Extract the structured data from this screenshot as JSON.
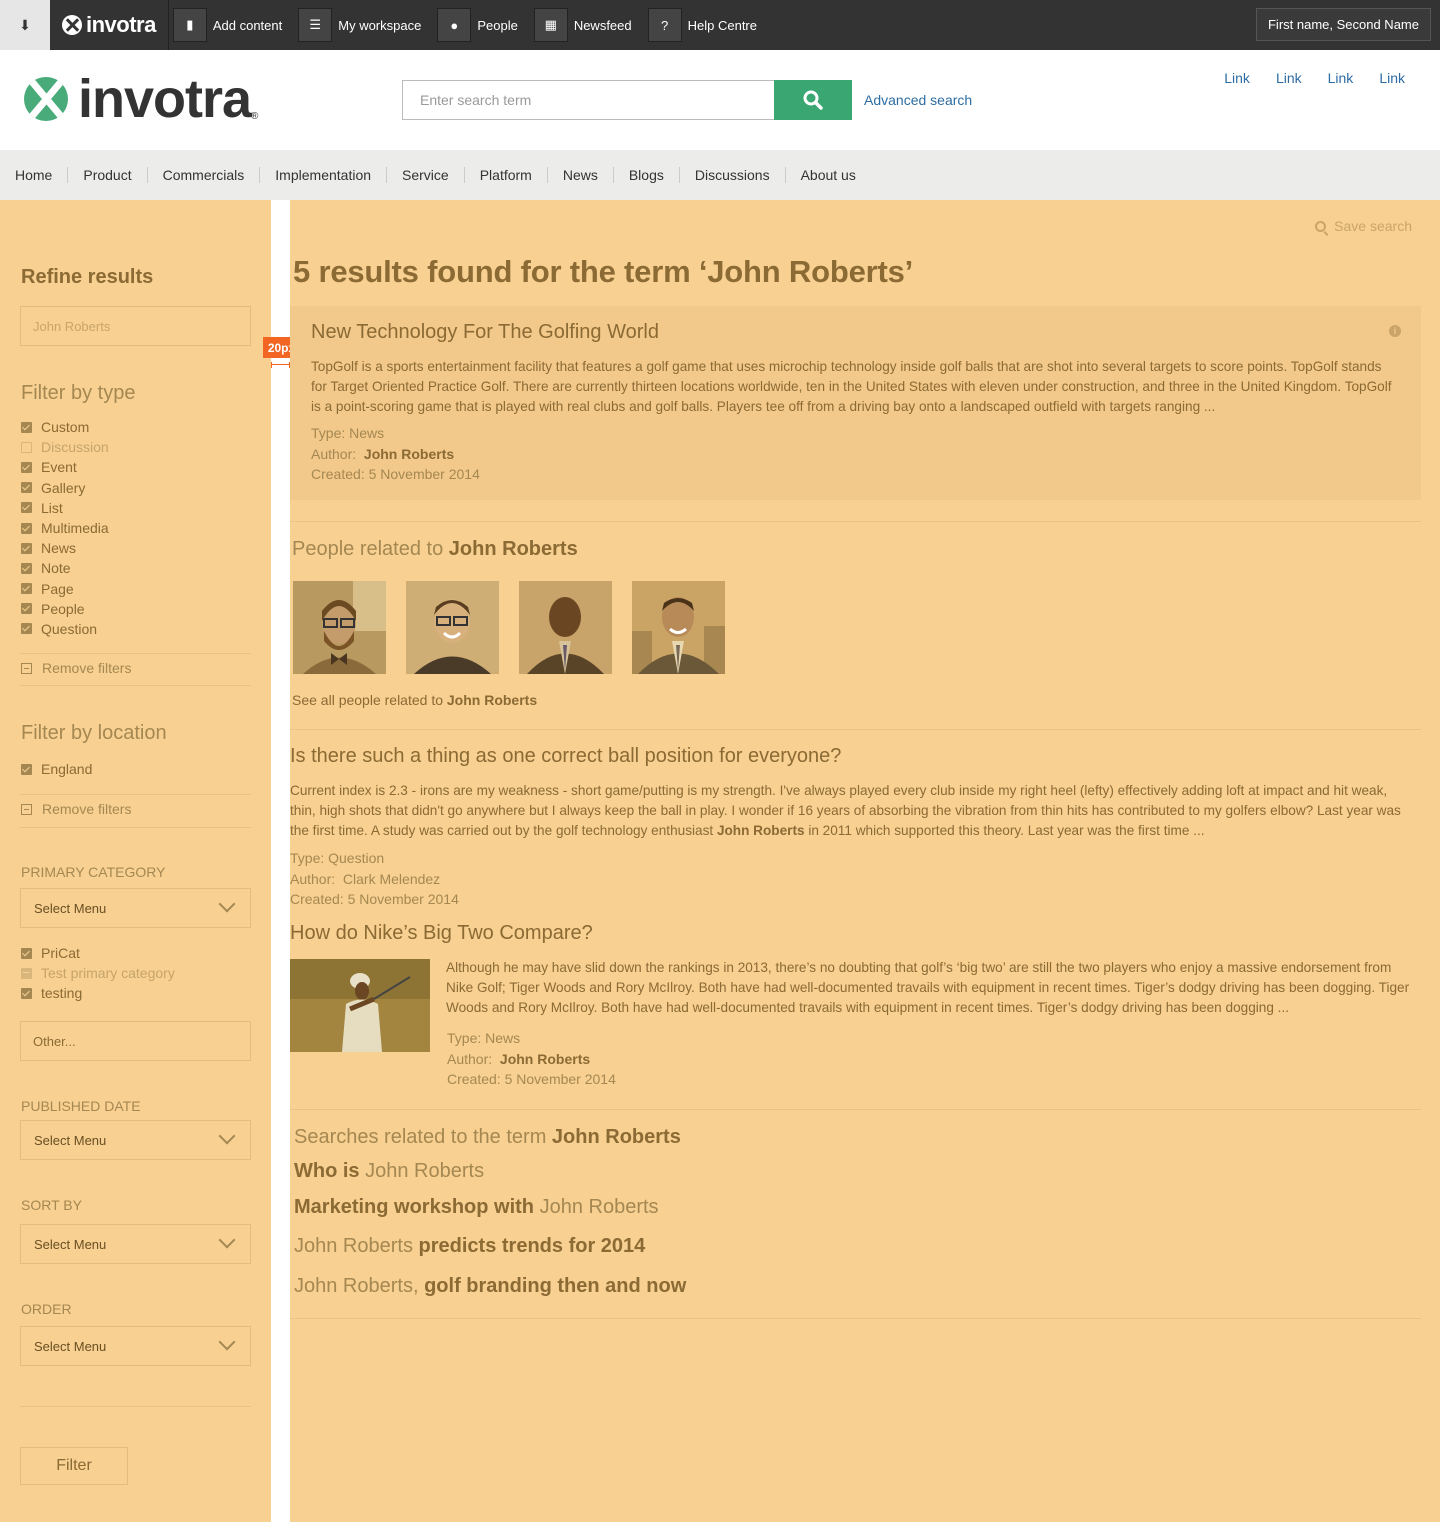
{
  "topbar": {
    "brand": "invotra",
    "items": [
      {
        "label": "Add content",
        "icon": "document-icon"
      },
      {
        "label": "My workspace",
        "icon": "list-icon"
      },
      {
        "label": "People",
        "icon": "people-icon"
      },
      {
        "label": "Newsfeed",
        "icon": "newspaper-icon"
      },
      {
        "label": "Help Centre",
        "icon": "question-icon"
      }
    ],
    "user": "First name, Second Name"
  },
  "header": {
    "logo": "invotra",
    "search_placeholder": "Enter search term",
    "advanced_search": "Advanced search",
    "links": [
      "Link",
      "Link",
      "Link",
      "Link"
    ]
  },
  "nav": [
    "Home",
    "Product",
    "Commercials",
    "Implementation",
    "Service",
    "Platform",
    "News",
    "Blogs",
    "Discussions",
    "About us"
  ],
  "sidebar": {
    "refine_title": "Refine results",
    "refine_value": "John Roberts",
    "filter_type_title": "Filter by type",
    "types": [
      {
        "label": "Custom",
        "state": "checked"
      },
      {
        "label": "Discussion",
        "state": "unchecked"
      },
      {
        "label": "Event",
        "state": "checked"
      },
      {
        "label": "Gallery",
        "state": "checked"
      },
      {
        "label": "List",
        "state": "checked"
      },
      {
        "label": "Multimedia",
        "state": "checked"
      },
      {
        "label": "News",
        "state": "checked"
      },
      {
        "label": "Note",
        "state": "checked"
      },
      {
        "label": "Page",
        "state": "checked"
      },
      {
        "label": "People",
        "state": "checked"
      },
      {
        "label": "Question",
        "state": "checked"
      }
    ],
    "remove_filters": "Remove filters",
    "filter_location_title": "Filter by location",
    "locations": [
      {
        "label": "England",
        "state": "checked"
      }
    ],
    "primary_category_caption": "PRIMARY CATEGORY",
    "primary_category_select": "Select Menu",
    "categories": [
      {
        "label": "PriCat",
        "state": "checked"
      },
      {
        "label": "Test primary category",
        "state": "indeterminate"
      },
      {
        "label": "testing",
        "state": "checked"
      }
    ],
    "other_placeholder": "Other...",
    "published_caption": "PUBLISHED DATE",
    "published_select": "Select Menu",
    "sort_caption": "SORT BY",
    "sort_select": "Select Menu",
    "order_caption": "ORDER",
    "order_select": "Select Menu",
    "filter_button": "Filter",
    "spacing_marker": "20px"
  },
  "main": {
    "save_search": "Save search",
    "results_title": "5 results found for the term ‘John Roberts’",
    "result1": {
      "title": "New Technology For The Golfing World",
      "body": "TopGolf is a sports entertainment facility that features a golf game that uses microchip technology inside golf balls that are shot into several targets to score points. TopGolf stands for Target Oriented Practice Golf. There are currently thirteen locations worldwide, ten in the United States with eleven under construction, and three in the United Kingdom. TopGolf is a point-scoring game that is played with real clubs and golf balls. Players tee off from a driving bay onto a landscaped outfield with targets ranging ...",
      "type": "Type: News",
      "author_label": "Author:",
      "author": "John Roberts",
      "created": "Created: 5 November 2014"
    },
    "people": {
      "title_prefix": "People related to",
      "title_name": "John Roberts",
      "see_all_prefix": "See all people related to",
      "see_all_name": "John Roberts"
    },
    "result2": {
      "title": "Is there such a thing as one correct ball position for everyone?",
      "body_1": "Current index is 2.3 - irons are my weakness - short game/putting is my strength. I've always played every club inside my right heel (lefty) effectively adding loft at impact and hit weak, thin, high shots that didn't go anywhere but I always keep the ball in play.  I wonder if 16 years of absorbing the vibration from thin hits has contributed to my golfers elbow? Last year was the first time.  A study was carried out by the golf technology enthusiast",
      "body_name": "John Roberts",
      "body_2": "in 2011 which supported this theory.  Last year was the first time ...",
      "type": "Type: Question",
      "author_label": "Author:",
      "author": "Clark Melendez",
      "created": "Created: 5 November 2014"
    },
    "result3": {
      "title": "How do Nike’s Big Two Compare?",
      "body": "Although he may have slid down the rankings in 2013, there’s no doubting that golf’s ‘big two’  are still the two players who enjoy a massive endorsement from Nike Golf; Tiger Woods and Rory McIlroy. Both have had well-documented travails with equipment in recent times. Tiger’s dodgy driving has been dogging. Tiger Woods and Rory McIlroy. Both have had well-documented travails with equipment in recent times. Tiger’s dodgy driving has been dogging ...",
      "type": "Type: News",
      "author_label": "Author:",
      "author": "John Roberts",
      "created": "Created: 5 November 2014"
    },
    "related": {
      "title_prefix": "Searches related to the term",
      "title_name": "John Roberts",
      "links": [
        {
          "a": "Who is",
          "b": "John Roberts",
          "bold_first": true
        },
        {
          "a": "Marketing workshop with",
          "b": "John Roberts",
          "bold_first": true
        },
        {
          "a": "John Roberts",
          "b": "predicts trends for 2014",
          "bold_first": false
        },
        {
          "a": "John Roberts,",
          "b": "golf branding then and now",
          "bold_first": false
        }
      ]
    }
  }
}
